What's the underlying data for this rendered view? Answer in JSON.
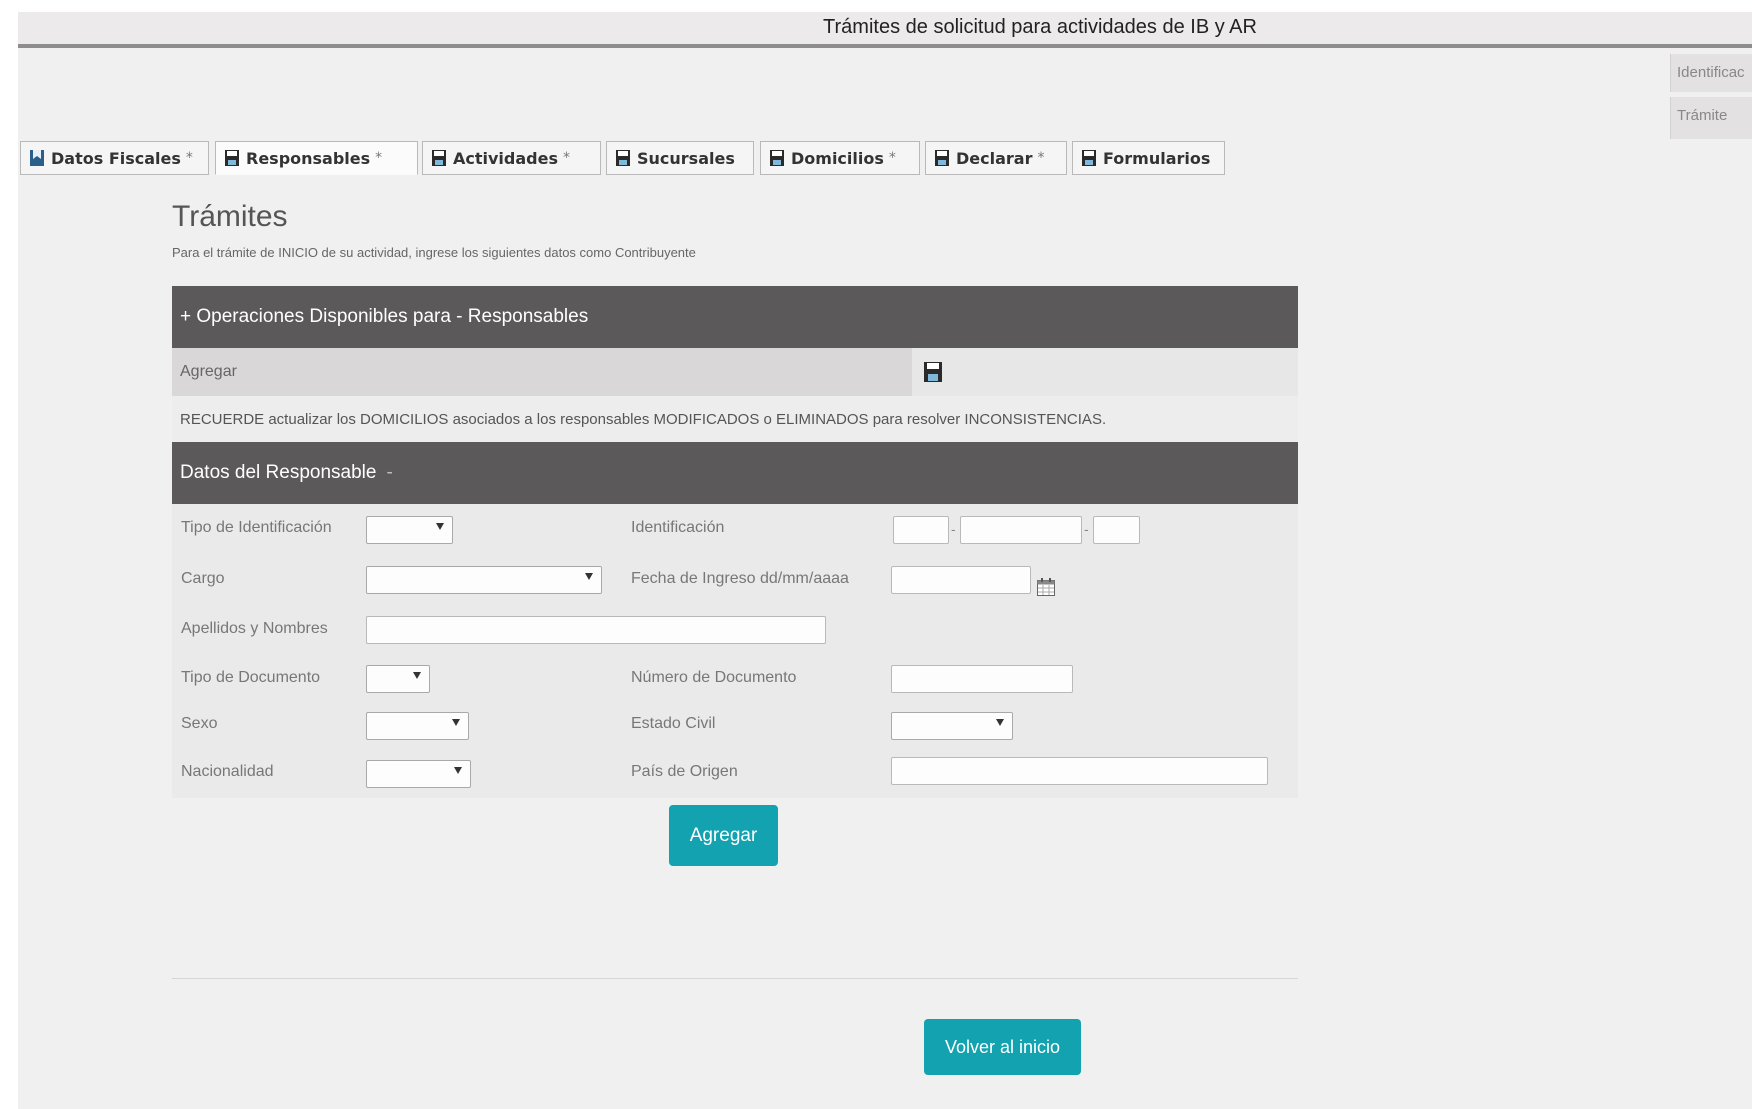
{
  "header": {
    "title": "Trámites de solicitud para actividades de IB y AR"
  },
  "side_tabs": [
    "Identificac",
    "Trámite"
  ],
  "tabs": [
    {
      "label": "Datos Fiscales",
      "star": "*"
    },
    {
      "label": "Responsables",
      "star": "*"
    },
    {
      "label": "Actividades",
      "star": "*"
    },
    {
      "label": "Sucursales",
      "star": ""
    },
    {
      "label": "Domicilios",
      "star": "*"
    },
    {
      "label": "Declarar",
      "star": "*"
    },
    {
      "label": "Formularios",
      "star": ""
    }
  ],
  "section": {
    "title": "Trámites",
    "subtitle": "Para el trámite de INICIO de su actividad, ingrese los siguientes datos como Contribuyente"
  },
  "operations_panel": {
    "title": "+ Operaciones Disponibles para - Responsables",
    "add_label": "Agregar",
    "notice": "RECUERDE actualizar los DOMICILIOS asociados a los responsables MODIFICADOS o ELIMINADOS para resolver INCONSISTENCIAS."
  },
  "responsable_panel": {
    "title": "Datos del Responsable",
    "collapse_symbol": "-"
  },
  "form": {
    "tipo_identificacion": "Tipo de Identificación",
    "identificacion": "Identificación",
    "cargo": "Cargo",
    "fecha_ingreso": "Fecha de Ingreso dd/mm/aaaa",
    "apellidos_nombres": "Apellidos y Nombres",
    "tipo_documento": "Tipo de Documento",
    "numero_documento": "Número de Documento",
    "sexo": "Sexo",
    "estado_civil": "Estado Civil",
    "nacionalidad": "Nacionalidad",
    "pais_origen": "País de Origen",
    "dash": "-"
  },
  "buttons": {
    "agregar": "Agregar",
    "volver": "Volver al inicio"
  },
  "colors": {
    "accent": "#13a2b0",
    "panel_header": "#5b5959",
    "tab_icon": "#2c5e8a"
  },
  "icons": {
    "tab_icon": "save-icon",
    "active_tab_icon": "bookmark-icon",
    "date_picker": "calendar-icon"
  }
}
